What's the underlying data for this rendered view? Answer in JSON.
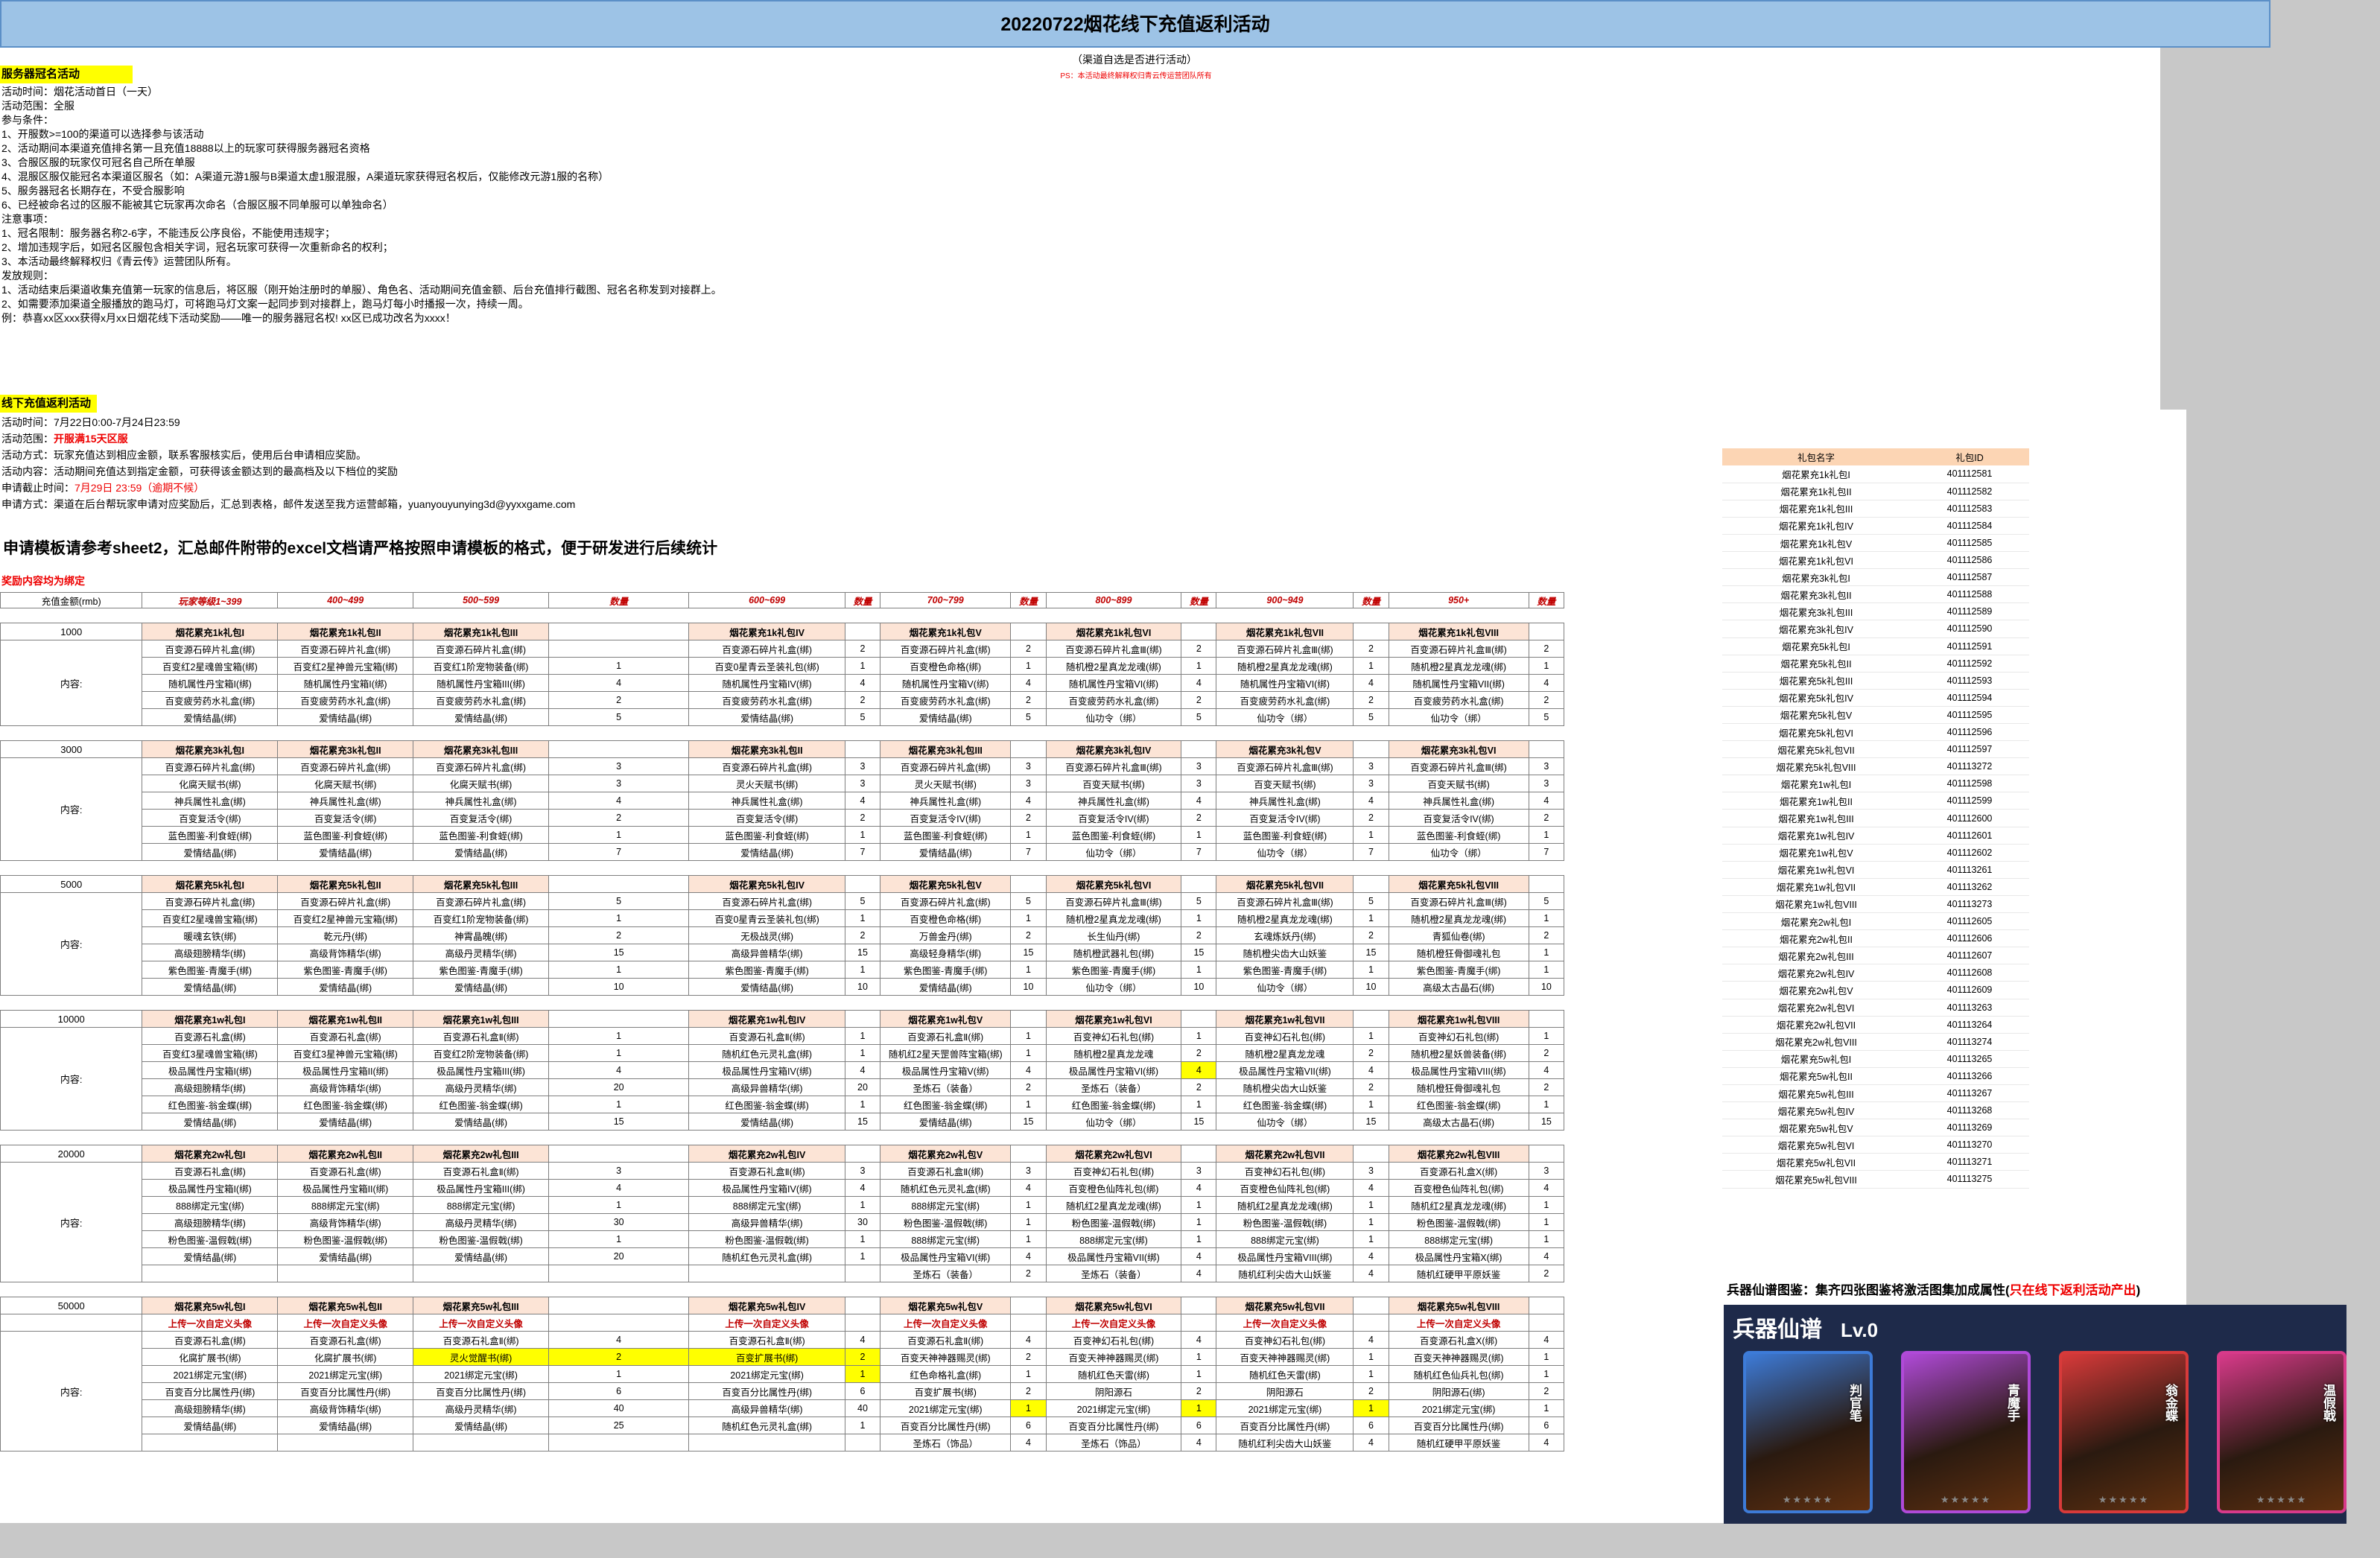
{
  "title": "20220722烟花线下充值返利活动",
  "subtitle": "（渠道自选是否进行活动）",
  "ps": "PS：本活动最终解释权归青云传运营团队所有",
  "s1": {
    "heading": "服务器冠名活动",
    "lines": [
      "活动时间：烟花活动首日（一天）",
      "活动范围：全服",
      "参与条件：",
      "1、开服数>=100的渠道可以选择参与该活动",
      "2、活动期间本渠道充值排名第一且充值18888以上的玩家可获得服务器冠名资格",
      "3、合服区服的玩家仅可冠名自己所在单服",
      "4、混服区服仅能冠名本渠道区服名（如：A渠道元游1服与B渠道太虚1服混服，A渠道玩家获得冠名权后，仅能修改元游1服的名称）",
      "5、服务器冠名长期存在，不受合服影响",
      "6、已经被命名过的区服不能被其它玩家再次命名（合服区服不同单服可以单独命名）",
      "注意事项：",
      "1、冠名限制：服务器名称2-6字，不能违反公序良俗，不能使用违规字；",
      "2、增加违规字后，如冠名区服包含相关字词，冠名玩家可获得一次重新命名的权利；",
      "3、本活动最终解释权归《青云传》运营团队所有。",
      "发放规则：",
      "1、活动结束后渠道收集充值第一玩家的信息后，将区服（刚开始注册时的单服）、角色名、活动期间充值金额、后台充值排行截图、冠名名称发到对接群上。",
      "2、如需要添加渠道全服播放的跑马灯，可将跑马灯文案一起同步到对接群上，跑马灯每小时播报一次，持续一周。",
      "例：恭喜xx区xxx获得x月xx日烟花线下活动奖励——唯一的服务器冠名权! xx区已成功改名为xxxx！"
    ]
  },
  "s2": {
    "heading": "线下充值返利活动",
    "time": "活动时间：7月22日0:00-7月24日23:59",
    "range_label": "活动范围：",
    "range": "开服满15天区服",
    "method": "活动方式：玩家充值达到相应金额，联系客服核实后，使用后台申请相应奖励。",
    "content": "活动内容：活动期间充值达到指定金额，可获得该金额达到的最高档及以下档位的奖励",
    "deadline_label": "申请截止时间：",
    "deadline": "7月29日 23:59（逾期不候）",
    "apply": "申请方式：渠道在后台帮玩家申请对应奖励后，汇总到表格，邮件发送至我方运营邮箱，yuanyouyunying3d@yyxxgame.com"
  },
  "big_note": "申请模板请参考sheet2，汇总邮件附带的excel文档请严格按照申请模板的格式，便于研发进行后续统计",
  "red_note": "奖励内容均为绑定",
  "table": {
    "header": [
      "充值金额(rmb)",
      "玩家等级1~399",
      "400~499",
      "500~599",
      "数量",
      "600~699",
      "数量",
      "700~799",
      "数量",
      "800~899",
      "数量",
      "900~949",
      "数量",
      "950+",
      "数量"
    ],
    "content_label": "内容:",
    "tiers": [
      {
        "amount": "1000",
        "packs": [
          "烟花累充1k礼包I",
          "烟花累充1k礼包II",
          "烟花累充1k礼包III",
          "",
          "烟花累充1k礼包IV",
          "",
          "烟花累充1k礼包V",
          "",
          "烟花累充1k礼包VI",
          "",
          "烟花累充1k礼包VII",
          "",
          "烟花累充1k礼包VIII",
          ""
        ],
        "rows": [
          [
            "百变源石碎片礼盒(绑)",
            "百变源石碎片礼盒(绑)",
            "百变源石碎片礼盒(绑)",
            "",
            "百变源石碎片礼盒(绑)",
            "2",
            "百变源石碎片礼盒(绑)",
            "2",
            "百变源石碎片礼盒Ⅲ(绑)",
            "2",
            "百变源石碎片礼盒Ⅲ(绑)",
            "2",
            "百变源石碎片礼盒Ⅲ(绑)",
            "2"
          ],
          [
            "百变红2星魂兽宝箱(绑)",
            "百变红2星神兽元宝箱(绑)",
            "百变红1阶宠物装备(绑)",
            "1",
            "百变0星青云圣装礼包(绑)",
            "1",
            "百变橙色命格(绑)",
            "1",
            "随机橙2星真龙龙魂(绑)",
            "1",
            "随机橙2星真龙龙魂(绑)",
            "1",
            "随机橙2星真龙龙魂(绑)",
            "1"
          ],
          [
            "随机属性丹宝箱I(绑)",
            "随机属性丹宝箱I(绑)",
            "随机属性丹宝箱III(绑)",
            "4",
            "随机属性丹宝箱IV(绑)",
            "4",
            "随机属性丹宝箱V(绑)",
            "4",
            "随机属性丹宝箱VI(绑)",
            "4",
            "随机属性丹宝箱VI(绑)",
            "4",
            "随机属性丹宝箱VII(绑)",
            "4"
          ],
          [
            "百变疲劳药水礼盒(绑)",
            "百变疲劳药水礼盒(绑)",
            "百变疲劳药水礼盒(绑)",
            "2",
            "百变疲劳药水礼盒(绑)",
            "2",
            "百变疲劳药水礼盒(绑)",
            "2",
            "百变疲劳药水礼盒(绑)",
            "2",
            "百变疲劳药水礼盒(绑)",
            "2",
            "百变疲劳药水礼盒(绑)",
            "2"
          ],
          [
            "爱情结晶(绑)",
            "爱情结晶(绑)",
            "爱情结晶(绑)",
            "5",
            "爱情结晶(绑)",
            "5",
            "爱情结晶(绑)",
            "5",
            "仙功令（绑）",
            "5",
            "仙功令（绑）",
            "5",
            "仙功令（绑）",
            "5"
          ]
        ]
      },
      {
        "amount": "3000",
        "packs": [
          "烟花累充3k礼包I",
          "烟花累充3k礼包II",
          "烟花累充3k礼包III",
          "",
          "烟花累充3k礼包II",
          "",
          "烟花累充3k礼包III",
          "",
          "烟花累充3k礼包IV",
          "",
          "烟花累充3k礼包V",
          "",
          "烟花累充3k礼包VI",
          ""
        ],
        "rows": [
          [
            "百变源石碎片礼盒(绑)",
            "百变源石碎片礼盒(绑)",
            "百变源石碎片礼盒(绑)",
            "3",
            "百变源石碎片礼盒(绑)",
            "3",
            "百变源石碎片礼盒(绑)",
            "3",
            "百变源石碎片礼盒Ⅲ(绑)",
            "3",
            "百变源石碎片礼盒Ⅲ(绑)",
            "3",
            "百变源石碎片礼盒Ⅲ(绑)",
            "3"
          ],
          [
            "化腐天赋书(绑)",
            "化腐天赋书(绑)",
            "化腐天赋书(绑)",
            "3",
            "灵火天赋书(绑)",
            "3",
            "灵火天赋书(绑)",
            "3",
            "百变天赋书(绑)",
            "3",
            "百变天赋书(绑)",
            "3",
            "百变天赋书(绑)",
            "3"
          ],
          [
            "神兵属性礼盒(绑)",
            "神兵属性礼盒(绑)",
            "神兵属性礼盒(绑)",
            "4",
            "神兵属性礼盒(绑)",
            "4",
            "神兵属性礼盒(绑)",
            "4",
            "神兵属性礼盒(绑)",
            "4",
            "神兵属性礼盒(绑)",
            "4",
            "神兵属性礼盒(绑)",
            "4"
          ],
          [
            "百变复活令(绑)",
            "百变复活令(绑)",
            "百变复活令(绑)",
            "2",
            "百变复活令(绑)",
            "2",
            "百变复活令IV(绑)",
            "2",
            "百变复活令IV(绑)",
            "2",
            "百变复活令IV(绑)",
            "2",
            "百变复活令IV(绑)",
            "2"
          ],
          [
            "蓝色图鉴-利食蛭(绑)",
            "蓝色图鉴-利食蛭(绑)",
            "蓝色图鉴-利食蛭(绑)",
            "1",
            "蓝色图鉴-利食蛭(绑)",
            "1",
            "蓝色图鉴-利食蛭(绑)",
            "1",
            "蓝色图鉴-利食蛭(绑)",
            "1",
            "蓝色图鉴-利食蛭(绑)",
            "1",
            "蓝色图鉴-利食蛭(绑)",
            "1"
          ],
          [
            "爱情结晶(绑)",
            "爱情结晶(绑)",
            "爱情结晶(绑)",
            "7",
            "爱情结晶(绑)",
            "7",
            "爱情结晶(绑)",
            "7",
            "仙功令（绑）",
            "7",
            "仙功令（绑）",
            "7",
            "仙功令（绑）",
            "7"
          ]
        ]
      },
      {
        "amount": "5000",
        "packs": [
          "烟花累充5k礼包I",
          "烟花累充5k礼包II",
          "烟花累充5k礼包III",
          "",
          "烟花累充5k礼包IV",
          "",
          "烟花累充5k礼包V",
          "",
          "烟花累充5k礼包VI",
          "",
          "烟花累充5k礼包VII",
          "",
          "烟花累充5k礼包VIII",
          ""
        ],
        "rows": [
          [
            "百变源石碎片礼盒(绑)",
            "百变源石碎片礼盒(绑)",
            "百变源石碎片礼盒(绑)",
            "5",
            "百变源石碎片礼盒(绑)",
            "5",
            "百变源石碎片礼盒(绑)",
            "5",
            "百变源石碎片礼盒Ⅲ(绑)",
            "5",
            "百变源石碎片礼盒Ⅲ(绑)",
            "5",
            "百变源石碎片礼盒Ⅲ(绑)",
            "5"
          ],
          [
            "百变红2星魂兽宝箱(绑)",
            "百变红2星神兽元宝箱(绑)",
            "百变红1阶宠物装备(绑)",
            "1",
            "百变0星青云圣装礼包(绑)",
            "1",
            "百变橙色命格(绑)",
            "1",
            "随机橙2星真龙龙魂(绑)",
            "1",
            "随机橙2星真龙龙魂(绑)",
            "1",
            "随机橙2星真龙龙魂(绑)",
            "1"
          ],
          [
            "暖魂玄铁(绑)",
            "乾元丹(绑)",
            "神霄晶魄(绑)",
            "2",
            "无极战灵(绑)",
            "2",
            "万兽金丹(绑)",
            "2",
            "长生仙丹(绑)",
            "2",
            "玄魂炼妖丹(绑)",
            "2",
            "青狐仙卷(绑)",
            "2"
          ],
          [
            "高级翅膀精华(绑)",
            "高级背饰精华(绑)",
            "高级丹灵精华(绑)",
            "15",
            "高级异兽精华(绑)",
            "15",
            "高级轻身精华(绑)",
            "15",
            "随机橙武器礼包(绑)",
            "15",
            "随机橙尖齿大山妖鉴",
            "15",
            "随机橙狂骨御魂礼包",
            "1"
          ],
          [
            "紫色图鉴-青魔手(绑)",
            "紫色图鉴-青魔手(绑)",
            "紫色图鉴-青魔手(绑)",
            "1",
            "紫色图鉴-青魔手(绑)",
            "1",
            "紫色图鉴-青魔手(绑)",
            "1",
            "紫色图鉴-青魔手(绑)",
            "1",
            "紫色图鉴-青魔手(绑)",
            "1",
            "紫色图鉴-青魔手(绑)",
            "1"
          ],
          [
            "爱情结晶(绑)",
            "爱情结晶(绑)",
            "爱情结晶(绑)",
            "10",
            "爱情结晶(绑)",
            "10",
            "爱情结晶(绑)",
            "10",
            "仙功令（绑）",
            "10",
            "仙功令（绑）",
            "10",
            "高级太古晶石(绑)",
            "10"
          ]
        ]
      },
      {
        "amount": "10000",
        "packs": [
          "烟花累充1w礼包I",
          "烟花累充1w礼包II",
          "烟花累充1w礼包III",
          "",
          "烟花累充1w礼包IV",
          "",
          "烟花累充1w礼包V",
          "",
          "烟花累充1w礼包VI",
          "",
          "烟花累充1w礼包VII",
          "",
          "烟花累充1w礼包VIII",
          ""
        ],
        "rows": [
          [
            "百变源石礼盒(绑)",
            "百变源石礼盒(绑)",
            "百变源石礼盒Ⅱ(绑)",
            "1",
            "百变源石礼盒Ⅱ(绑)",
            "1",
            "百变源石礼盒Ⅱ(绑)",
            "1",
            "百变神幻石礼包(绑)",
            "1",
            "百变神幻石礼包(绑)",
            "1",
            "百变神幻石礼包(绑)",
            "1"
          ],
          [
            "百变红3星魂兽宝箱(绑)",
            "百变红3星神兽元宝箱(绑)",
            "百变红2阶宠物装备(绑)",
            "1",
            "随机红色元灵礼盒(绑)",
            "1",
            "随机红2星天罡兽阵宝箱(绑)",
            "1",
            "随机橙2星真龙龙魂",
            "2",
            "随机橙2星真龙龙魂",
            "2",
            "随机橙2星妖兽装备(绑)",
            "2"
          ],
          [
            "极品属性丹宝箱I(绑)",
            "极品属性丹宝箱II(绑)",
            "极品属性丹宝箱III(绑)",
            "4",
            "极品属性丹宝箱IV(绑)",
            "4",
            "极品属性丹宝箱V(绑)",
            "4",
            "极品属性丹宝箱VI(绑)",
            "4",
            "极品属性丹宝箱VII(绑)",
            "4",
            "极品属性丹宝箱VIII(绑)",
            "4"
          ],
          [
            "高级翅膀精华(绑)",
            "高级背饰精华(绑)",
            "高级丹灵精华(绑)",
            "20",
            "高级异兽精华(绑)",
            "20",
            "圣炼石（装备）",
            "2",
            "圣炼石（装备）",
            "2",
            "随机橙尖齿大山妖鉴",
            "2",
            "随机橙狂骨御魂礼包",
            "2"
          ],
          [
            "红色图鉴-翁金蝶(绑)",
            "红色图鉴-翁金蝶(绑)",
            "红色图鉴-翁金蝶(绑)",
            "1",
            "红色图鉴-翁金蝶(绑)",
            "1",
            "红色图鉴-翁金蝶(绑)",
            "1",
            "红色图鉴-翁金蝶(绑)",
            "1",
            "红色图鉴-翁金蝶(绑)",
            "1",
            "红色图鉴-翁金蝶(绑)",
            "1"
          ],
          [
            "爱情结晶(绑)",
            "爱情结晶(绑)",
            "爱情结晶(绑)",
            "15",
            "爱情结晶(绑)",
            "15",
            "爱情结晶(绑)",
            "15",
            "仙功令（绑）",
            "15",
            "仙功令（绑）",
            "15",
            "高级太古晶石(绑)",
            "15"
          ]
        ]
      },
      {
        "amount": "20000",
        "packs": [
          "烟花累充2w礼包I",
          "烟花累充2w礼包II",
          "烟花累充2w礼包III",
          "",
          "烟花累充2w礼包IV",
          "",
          "烟花累充2w礼包V",
          "",
          "烟花累充2w礼包VI",
          "",
          "烟花累充2w礼包VII",
          "",
          "烟花累充2w礼包VIII",
          ""
        ],
        "rows": [
          [
            "百变源石礼盒(绑)",
            "百变源石礼盒(绑)",
            "百变源石礼盒Ⅱ(绑)",
            "3",
            "百变源石礼盒Ⅱ(绑)",
            "3",
            "百变源石礼盒Ⅱ(绑)",
            "3",
            "百变神幻石礼包(绑)",
            "3",
            "百变神幻石礼包(绑)",
            "3",
            "百变源石礼盒X(绑)",
            "3"
          ],
          [
            "极品属性丹宝箱I(绑)",
            "极品属性丹宝箱II(绑)",
            "极品属性丹宝箱III(绑)",
            "4",
            "极品属性丹宝箱IV(绑)",
            "4",
            "随机红色元灵礼盒(绑)",
            "4",
            "百变橙色仙阵礼包(绑)",
            "4",
            "百变橙色仙阵礼包(绑)",
            "4",
            "百变橙色仙阵礼包(绑)",
            "4"
          ],
          [
            "888绑定元宝(绑)",
            "888绑定元宝(绑)",
            "888绑定元宝(绑)",
            "1",
            "888绑定元宝(绑)",
            "1",
            "888绑定元宝(绑)",
            "1",
            "随机红2星真龙龙魂(绑)",
            "1",
            "随机红2星真龙龙魂(绑)",
            "1",
            "随机红2星真龙龙魂(绑)",
            "1"
          ],
          [
            "高级翅膀精华(绑)",
            "高级背饰精华(绑)",
            "高级丹灵精华(绑)",
            "30",
            "高级异兽精华(绑)",
            "30",
            "粉色图鉴-温假戟(绑)",
            "1",
            "粉色图鉴-温假戟(绑)",
            "1",
            "粉色图鉴-温假戟(绑)",
            "1",
            "粉色图鉴-温假戟(绑)",
            "1"
          ],
          [
            "粉色图鉴-温假戟(绑)",
            "粉色图鉴-温假戟(绑)",
            "粉色图鉴-温假戟(绑)",
            "1",
            "粉色图鉴-温假戟(绑)",
            "1",
            "888绑定元宝(绑)",
            "1",
            "888绑定元宝(绑)",
            "1",
            "888绑定元宝(绑)",
            "1",
            "888绑定元宝(绑)",
            "1"
          ],
          [
            "爱情结晶(绑)",
            "爱情结晶(绑)",
            "爱情结晶(绑)",
            "20",
            "随机红色元灵礼盒(绑)",
            "1",
            "极品属性丹宝箱VI(绑)",
            "4",
            "极品属性丹宝箱VII(绑)",
            "4",
            "极品属性丹宝箱VIII(绑)",
            "4",
            "极品属性丹宝箱X(绑)",
            "4"
          ],
          [
            "",
            "",
            "",
            "",
            "",
            "",
            "圣炼石（装备）",
            "2",
            "圣炼石（装备）",
            "4",
            "随机红利尖齿大山妖鉴",
            "4",
            "随机红硬甲平原妖鉴",
            "2"
          ]
        ]
      },
      {
        "amount": "50000",
        "packs": [
          "烟花累充5w礼包I",
          "烟花累充5w礼包II",
          "烟花累充5w礼包III",
          "",
          "烟花累充5w礼包IV",
          "",
          "烟花累充5w礼包V",
          "",
          "烟花累充5w礼包VI",
          "",
          "烟花累充5w礼包VII",
          "",
          "烟花累充5w礼包VIII",
          ""
        ],
        "upload": "上传一次自定义头像",
        "rows": [
          [
            "百变源石礼盒(绑)",
            "百变源石礼盒(绑)",
            "百变源石礼盒Ⅱ(绑)",
            "4",
            "百变源石礼盒Ⅱ(绑)",
            "4",
            "百变源石礼盒Ⅱ(绑)",
            "4",
            "百变神幻石礼包(绑)",
            "4",
            "百变神幻石礼包(绑)",
            "4",
            "百变源石礼盒X(绑)",
            "4"
          ],
          [
            "化腐扩展书(绑)",
            "化腐扩展书(绑)",
            "灵火觉醒书(绑)",
            "2",
            "百变扩展书(绑)",
            "2",
            "百变天神神器赐灵(绑)",
            "2",
            "百变天神神器赐灵(绑)",
            "1",
            "百变天神神器赐灵(绑)",
            "1",
            "百变天神神器赐灵(绑)",
            "1"
          ],
          [
            "2021绑定元宝(绑)",
            "2021绑定元宝(绑)",
            "2021绑定元宝(绑)",
            "1",
            "2021绑定元宝(绑)",
            "1",
            "红色命格礼盒(绑)",
            "1",
            "随机红色天雷(绑)",
            "1",
            "随机红色天雷(绑)",
            "1",
            "随机红色仙兵礼包(绑)",
            "1"
          ],
          [
            "百变百分比属性丹(绑)",
            "百变百分比属性丹(绑)",
            "百变百分比属性丹(绑)",
            "6",
            "百变百分比属性丹(绑)",
            "6",
            "百变扩展书(绑)",
            "2",
            "阴阳源石",
            "2",
            "阴阳源石",
            "2",
            "阴阳源石(绑)",
            "2"
          ],
          [
            "高级翅膀精华(绑)",
            "高级背饰精华(绑)",
            "高级丹灵精华(绑)",
            "40",
            "高级异兽精华(绑)",
            "40",
            "2021绑定元宝(绑)",
            "1",
            "2021绑定元宝(绑)",
            "1",
            "2021绑定元宝(绑)",
            "1",
            "2021绑定元宝(绑)",
            "1"
          ],
          [
            "爱情结晶(绑)",
            "爱情结晶(绑)",
            "爱情结晶(绑)",
            "25",
            "随机红色元灵礼盒(绑)",
            "1",
            "百变百分比属性丹(绑)",
            "6",
            "百变百分比属性丹(绑)",
            "6",
            "百变百分比属性丹(绑)",
            "6",
            "百变百分比属性丹(绑)",
            "6"
          ],
          [
            "",
            "",
            "",
            "",
            "",
            "",
            "圣炼石（饰品）",
            "4",
            "圣炼石（饰品）",
            "4",
            "随机红利尖齿大山妖鉴",
            "4",
            "随机红硬甲平原妖鉴",
            "4"
          ]
        ]
      }
    ]
  },
  "ids": {
    "header": [
      "礼包名字",
      "礼包ID"
    ],
    "rows": [
      [
        "烟花累充1k礼包I",
        "401112581"
      ],
      [
        "烟花累充1k礼包II",
        "401112582"
      ],
      [
        "烟花累充1k礼包III",
        "401112583"
      ],
      [
        "烟花累充1k礼包IV",
        "401112584"
      ],
      [
        "烟花累充1k礼包V",
        "401112585"
      ],
      [
        "烟花累充1k礼包VI",
        "401112586"
      ],
      [
        "烟花累充3k礼包I",
        "401112587"
      ],
      [
        "烟花累充3k礼包II",
        "401112588"
      ],
      [
        "烟花累充3k礼包III",
        "401112589"
      ],
      [
        "烟花累充3k礼包IV",
        "401112590"
      ],
      [
        "烟花累充5k礼包I",
        "401112591"
      ],
      [
        "烟花累充5k礼包II",
        "401112592"
      ],
      [
        "烟花累充5k礼包III",
        "401112593"
      ],
      [
        "烟花累充5k礼包IV",
        "401112594"
      ],
      [
        "烟花累充5k礼包V",
        "401112595"
      ],
      [
        "烟花累充5k礼包VI",
        "401112596"
      ],
      [
        "烟花累充5k礼包VII",
        "401112597"
      ],
      [
        "烟花累充5k礼包VIII",
        "401113272"
      ],
      [
        "烟花累充1w礼包I",
        "401112598"
      ],
      [
        "烟花累充1w礼包II",
        "401112599"
      ],
      [
        "烟花累充1w礼包III",
        "401112600"
      ],
      [
        "烟花累充1w礼包IV",
        "401112601"
      ],
      [
        "烟花累充1w礼包V",
        "401112602"
      ],
      [
        "烟花累充1w礼包VI",
        "401113261"
      ],
      [
        "烟花累充1w礼包VII",
        "401113262"
      ],
      [
        "烟花累充1w礼包VIII",
        "401113273"
      ],
      [
        "烟花累充2w礼包I",
        "401112605"
      ],
      [
        "烟花累充2w礼包II",
        "401112606"
      ],
      [
        "烟花累充2w礼包III",
        "401112607"
      ],
      [
        "烟花累充2w礼包IV",
        "401112608"
      ],
      [
        "烟花累充2w礼包V",
        "401112609"
      ],
      [
        "烟花累充2w礼包VI",
        "401113263"
      ],
      [
        "烟花累充2w礼包VII",
        "401113264"
      ],
      [
        "烟花累充2w礼包VIII",
        "401113274"
      ],
      [
        "烟花累充5w礼包I",
        "401113265"
      ],
      [
        "烟花累充5w礼包II",
        "401113266"
      ],
      [
        "烟花累充5w礼包III",
        "401113267"
      ],
      [
        "烟花累充5w礼包IV",
        "401113268"
      ],
      [
        "烟花累充5w礼包V",
        "401113269"
      ],
      [
        "烟花累充5w礼包VI",
        "401113270"
      ],
      [
        "烟花累充5w礼包VII",
        "401113271"
      ],
      [
        "烟花累充5w礼包VIII",
        "401113275"
      ]
    ]
  },
  "armory": {
    "title_black": "兵器仙谱图鉴：集齐四张图鉴将激活图集加成属性(",
    "title_red": "只在线下返利活动产出",
    "title_end": ")",
    "header": "兵器仙谱",
    "level": "Lv.0",
    "cards": [
      {
        "name": "判官笔",
        "color": "#3d7bd8"
      },
      {
        "name": "青魔手",
        "color": "#b04ad8"
      },
      {
        "name": "翁金蝶",
        "color": "#d83a3a"
      },
      {
        "name": "温假戟",
        "color": "#d83a8a"
      }
    ]
  },
  "colors": {
    "title_bg": "#9dc3e6",
    "yellow": "#ffff00",
    "pack_bg": "#fce4d6",
    "red": "#c00000"
  }
}
